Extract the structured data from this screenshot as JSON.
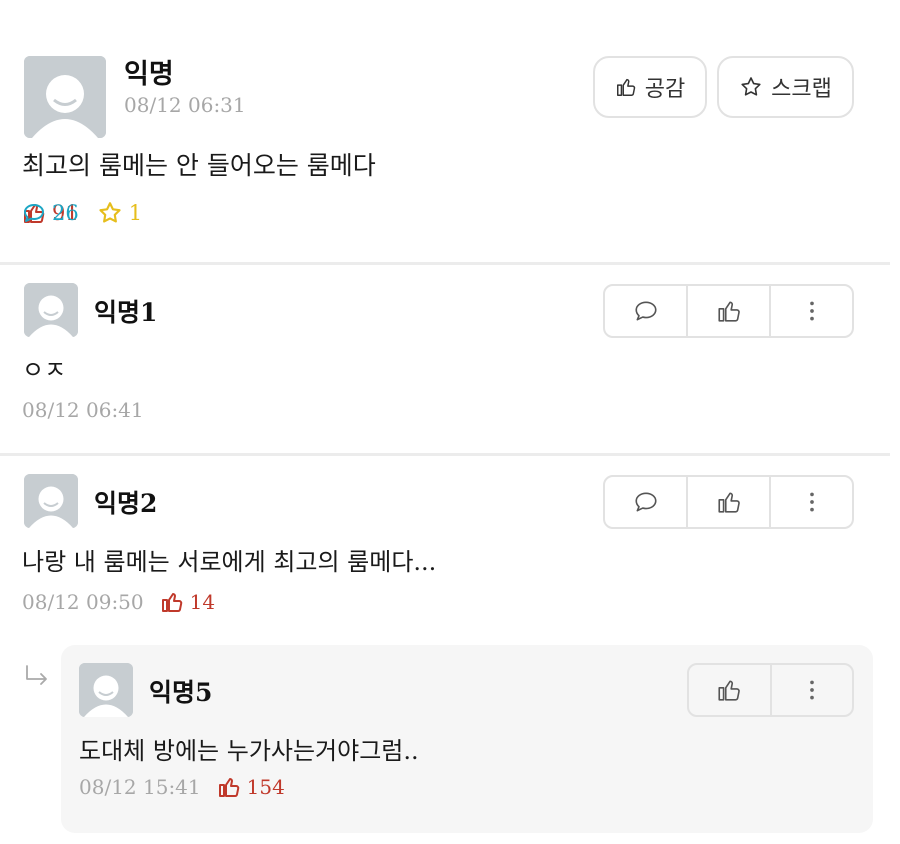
{
  "post": {
    "author": "익명",
    "time": "08/12 06:31",
    "content": "최고의 룸메는 안 들어오는 룸메다",
    "stats": {
      "likes": "91",
      "comments": "26",
      "scraps": "1"
    },
    "buttons": {
      "empathy_label": "공감",
      "scrap_label": "스크랩"
    }
  },
  "comments": [
    {
      "author": "익명1",
      "content": "ㅇㅈ",
      "time": "08/12 06:41"
    },
    {
      "author": "익명2",
      "content": "나랑 내 룸메는 서로에게 최고의 룸메다...",
      "time": "08/12 09:50",
      "likes": "14"
    }
  ],
  "reply": {
    "author": "익명5",
    "content": "도대체 방에는 누가사는거야그럼..",
    "time": "08/12 15:41",
    "likes": "154"
  },
  "colors": {
    "like": "#c0392b",
    "comment": "#1ca6c4",
    "scrap": "#e6be1c",
    "time": "#a7a7a7",
    "border": "#e2e2e2",
    "reply_bg": "#f6f6f6"
  },
  "icons": [
    "thumbs-up-icon",
    "speech-bubble-icon",
    "star-icon",
    "more-vertical-icon",
    "reply-arrow-icon",
    "avatar-icon"
  ]
}
